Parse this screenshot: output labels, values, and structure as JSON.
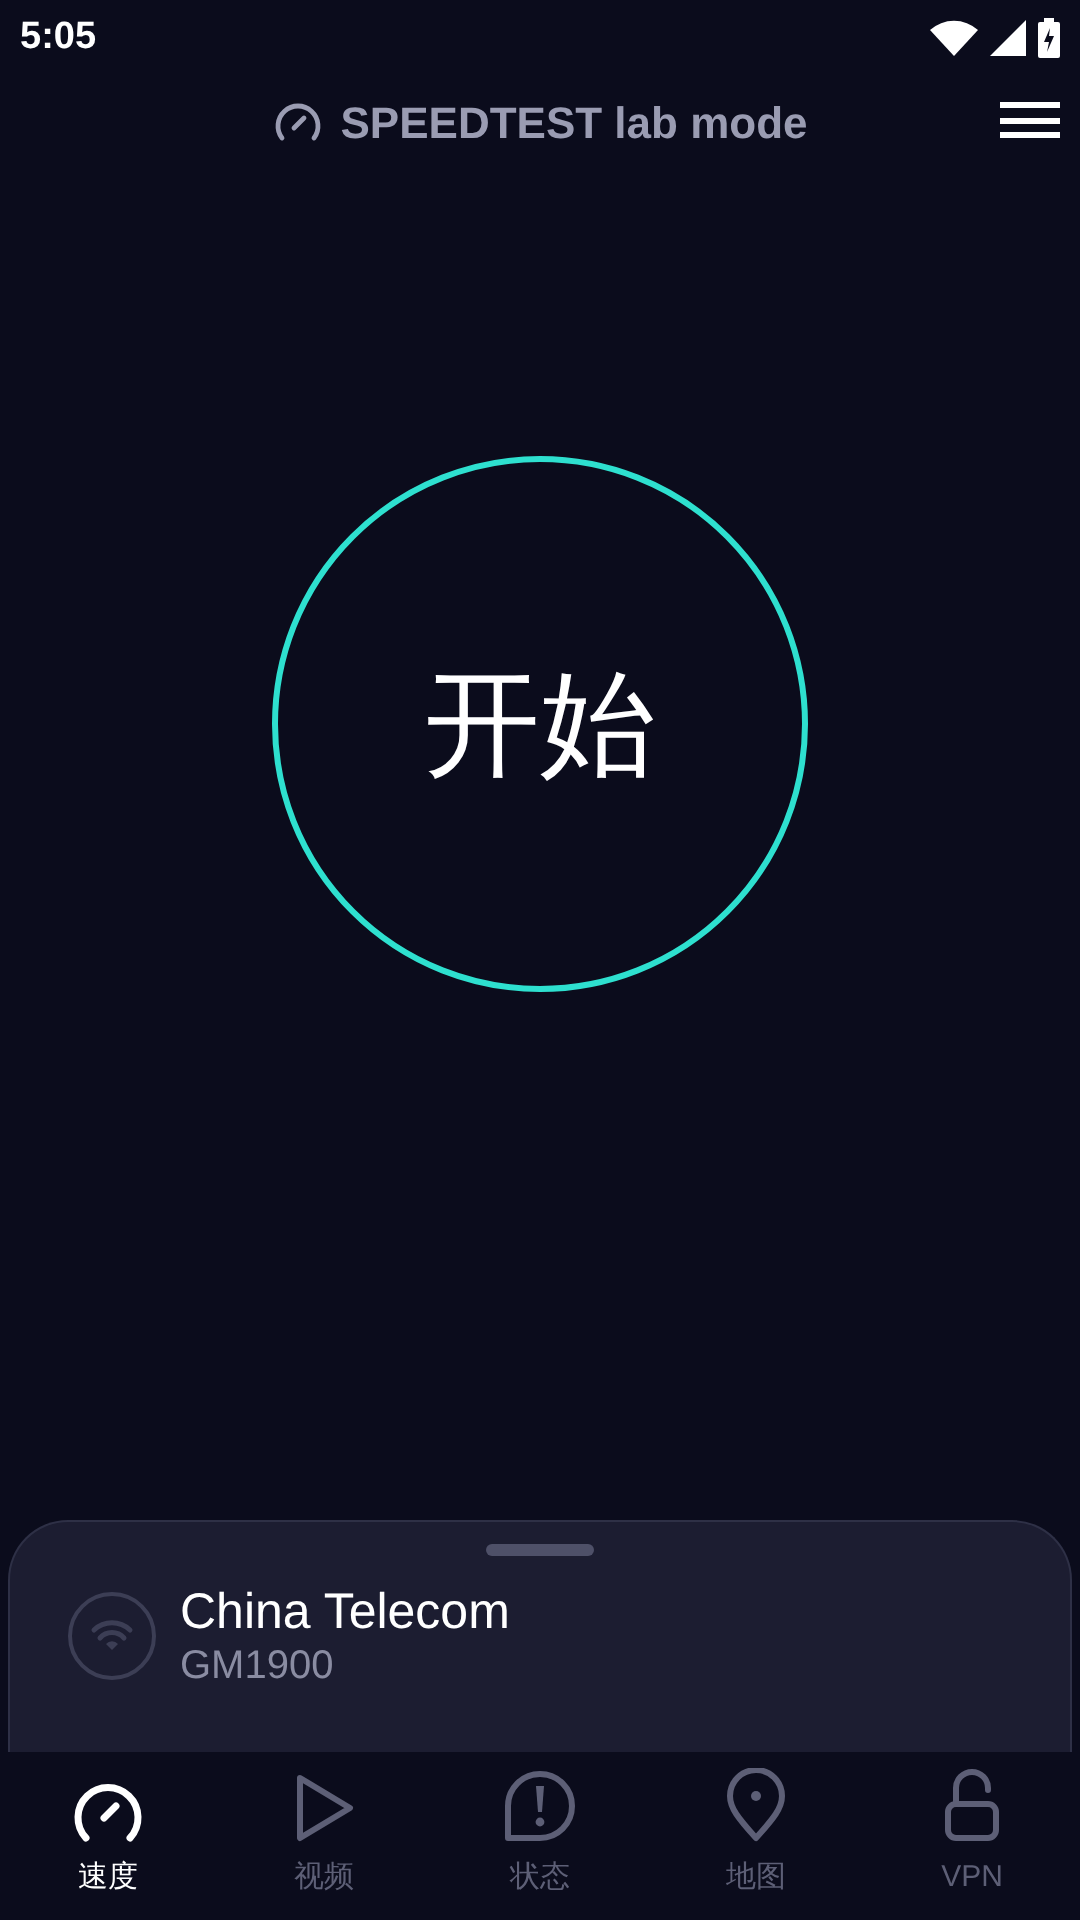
{
  "status_bar": {
    "time": "5:05"
  },
  "header": {
    "title": "SPEEDTEST lab mode"
  },
  "start_button": {
    "label": "开始"
  },
  "connection": {
    "name": "China Telecom",
    "device": "GM1900"
  },
  "nav": [
    {
      "kind": "speed",
      "label": "速度",
      "selected": true
    },
    {
      "kind": "video",
      "label": "视频",
      "selected": false
    },
    {
      "kind": "status",
      "label": "状态",
      "selected": false
    },
    {
      "kind": "map",
      "label": "地图",
      "selected": false
    },
    {
      "kind": "vpn",
      "label": "VPN",
      "selected": false
    }
  ]
}
